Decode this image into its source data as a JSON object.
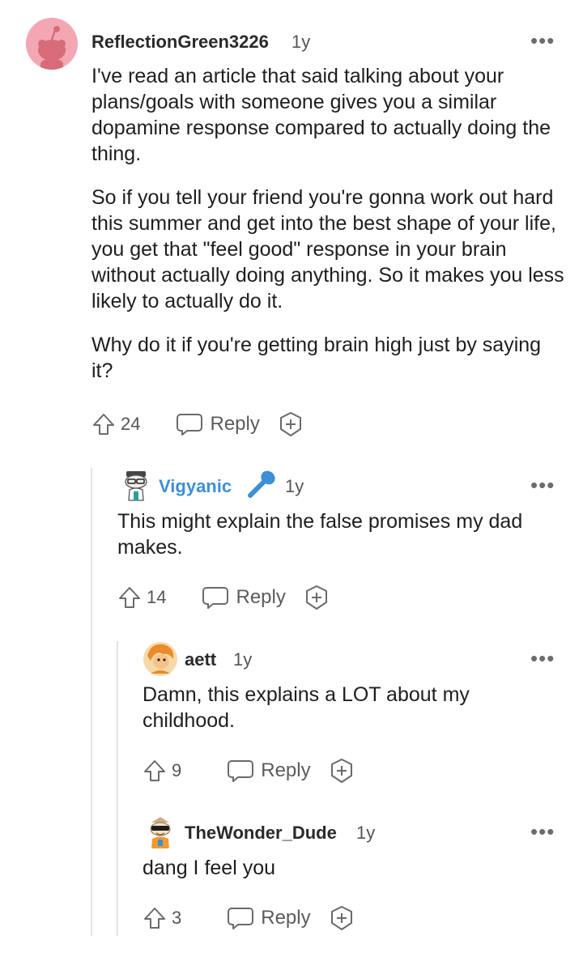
{
  "comments": [
    {
      "username": "ReflectionGreen3226",
      "age": "1y",
      "paragraphs": [
        "I've read an article that said talking about your plans/goals with someone gives you a similar dopamine response compared to actually doing the thing.",
        "So if you tell your friend you're gonna work out hard this summer and get into the best shape of your life, you get that \"feel good\" response in your brain without actually doing anything. So it makes you less likely to actually do it.",
        "Why do it if you're getting brain high just by saying it?"
      ],
      "votes": "24",
      "reply_label": "Reply"
    },
    {
      "username": "Vigyanic",
      "age": "1y",
      "text": "This might explain the false promises my dad makes.",
      "votes": "14",
      "reply_label": "Reply"
    },
    {
      "username": "aett",
      "age": "1y",
      "text": "Damn, this explains a LOT about my childhood.",
      "votes": "9",
      "reply_label": "Reply"
    },
    {
      "username": "TheWonder_Dude",
      "age": "1y",
      "text": "dang I feel you",
      "votes": "3",
      "reply_label": "Reply"
    }
  ],
  "more_glyph": "•••",
  "colors": {
    "mod_blue": "#3d8fd6",
    "avatar_pink": "#f3a7b3"
  }
}
